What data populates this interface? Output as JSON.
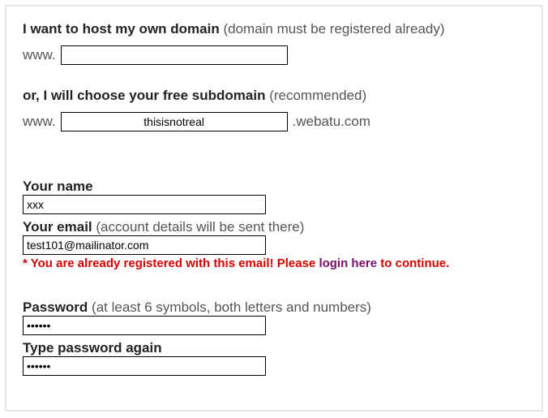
{
  "section1": {
    "title_bold": "I want to host my own domain",
    "title_note": "(domain must be registered already)",
    "prefix": "www.",
    "input_value": ""
  },
  "section2": {
    "title_bold": "or, I will choose your free subdomain",
    "title_note": "(recommended)",
    "prefix": "www.",
    "input_value": "thisisnotreal",
    "suffix": ".webatu.com"
  },
  "name": {
    "label_bold": "Your name",
    "value": "xxx"
  },
  "email": {
    "label_bold": "Your email",
    "label_note": "(account details will be sent there)",
    "value": "test101@mailinator.com",
    "error_prefix": "* You are already registered with this email! Please ",
    "error_link": "login here",
    "error_suffix": " to continue."
  },
  "password": {
    "label_bold": "Password",
    "label_note": "(at least 6 symbols, both letters and numbers)",
    "value": "••••••"
  },
  "password2": {
    "label_bold": "Type password again",
    "value": "••••••"
  }
}
